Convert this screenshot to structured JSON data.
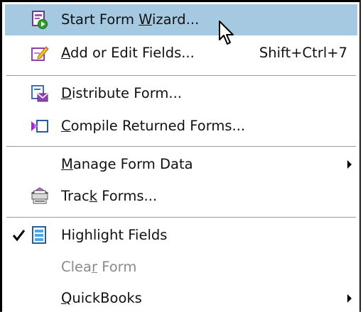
{
  "menu": {
    "items": [
      {
        "label": "Start Form Wizard...",
        "mnemonic_index": 11,
        "icon": "form-wizard-icon"
      },
      {
        "label": "Add or Edit Fields...",
        "mnemonic_index": 0,
        "shortcut": "Shift+Ctrl+7",
        "icon": "edit-fields-icon"
      },
      {
        "label": "Distribute Form...",
        "mnemonic_index": 0,
        "icon": "distribute-form-icon"
      },
      {
        "label": "Compile Returned Forms...",
        "mnemonic_index": 0,
        "icon": "compile-forms-icon"
      },
      {
        "label": "Manage Form Data",
        "mnemonic_index": 0,
        "has_submenu": true
      },
      {
        "label": "Track Forms...",
        "mnemonic_index": 4,
        "icon": "track-forms-icon"
      },
      {
        "label": "Highlight Fields",
        "mnemonic_index": 6,
        "checked": true,
        "icon": "highlight-fields-icon"
      },
      {
        "label": "Clear Form",
        "mnemonic_index": 4,
        "disabled": true
      },
      {
        "label": "QuickBooks",
        "mnemonic_index": 0,
        "has_submenu": true
      }
    ]
  },
  "colors": {
    "highlight": "#a6c9e2",
    "disabled_text": "#8a8a8a",
    "border": "#000000"
  }
}
